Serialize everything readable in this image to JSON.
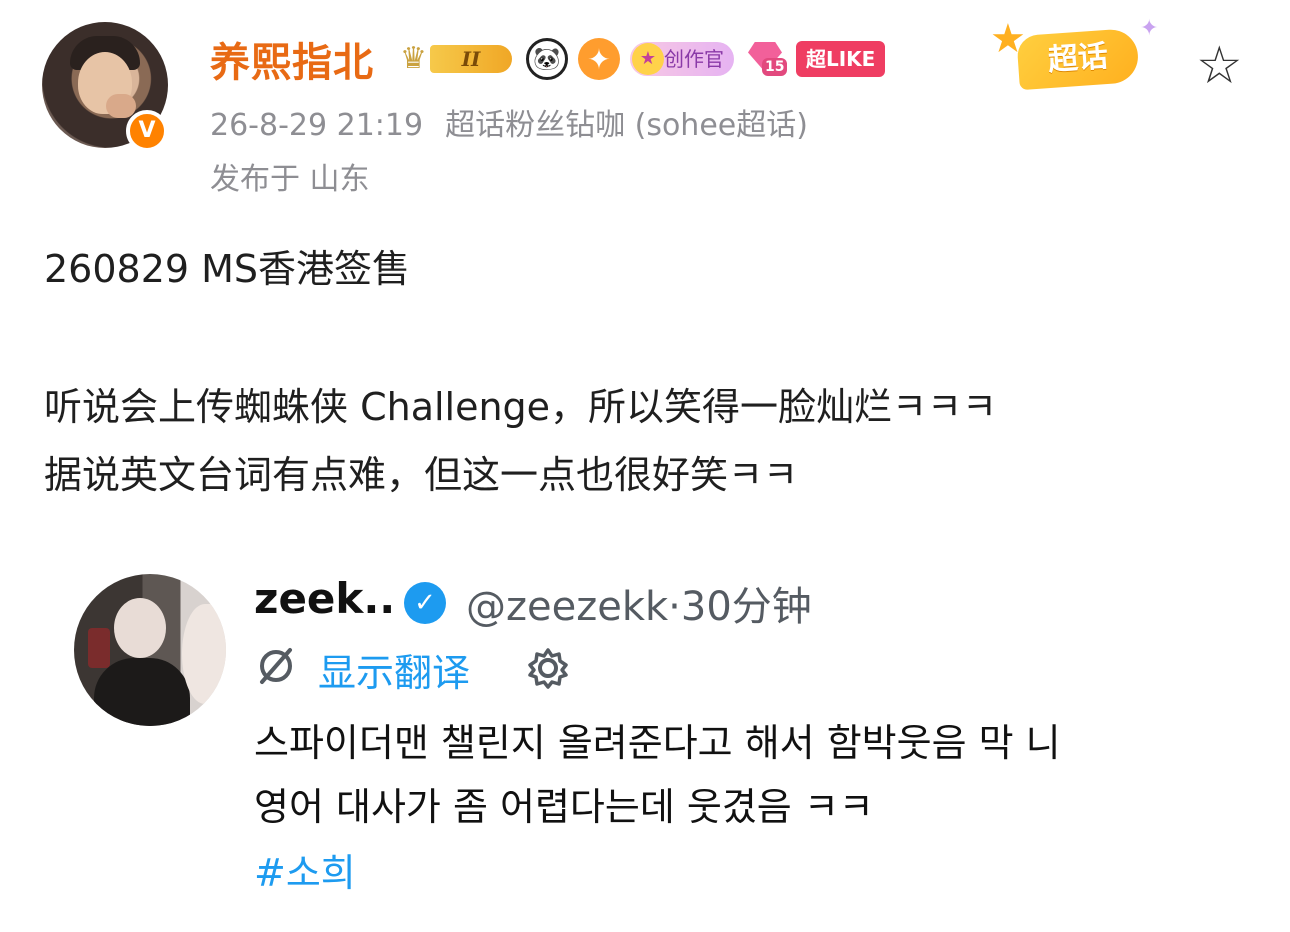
{
  "author": {
    "name": "养熙指北",
    "verified_mark": "V",
    "level_badge": "II",
    "creator_badge": "创作官",
    "diamond_level": "15",
    "like_badge": "超LIKE",
    "supertopic_tag": "超话"
  },
  "meta": {
    "datetime": "26-8-29 21:19",
    "source": "超话粉丝钻咖 (sohee超话)",
    "location": "发布于 山东"
  },
  "post": {
    "title": "260829 MS香港签售",
    "line1": "听说会上传蜘蛛侠 Challenge，所以笑得一脸灿烂ㅋㅋㅋ",
    "line2": "据说英文台词有点难，但这一点也很好笑ㅋㅋ"
  },
  "tweet": {
    "name": "zeek..",
    "handle": "@zeezekk·30分钟",
    "translate_label": "显示翻译",
    "line1": "스파이더맨 챌린지 올려준다고 해서 함박웃음 막 니",
    "line2": "영어 대사가 좀 어렵다는데 웃겼음 ㅋㅋ",
    "hashtag": "#소희"
  },
  "colors": {
    "username": "#e86a14",
    "meta_gray": "#8e8e93",
    "link_blue": "#1d9bf0",
    "verified_orange": "#ff8200"
  },
  "icons": {
    "follow": "star-outline-icon",
    "translate": "translate-icon",
    "settings": "gear-icon",
    "verified": "checkmark-icon"
  }
}
